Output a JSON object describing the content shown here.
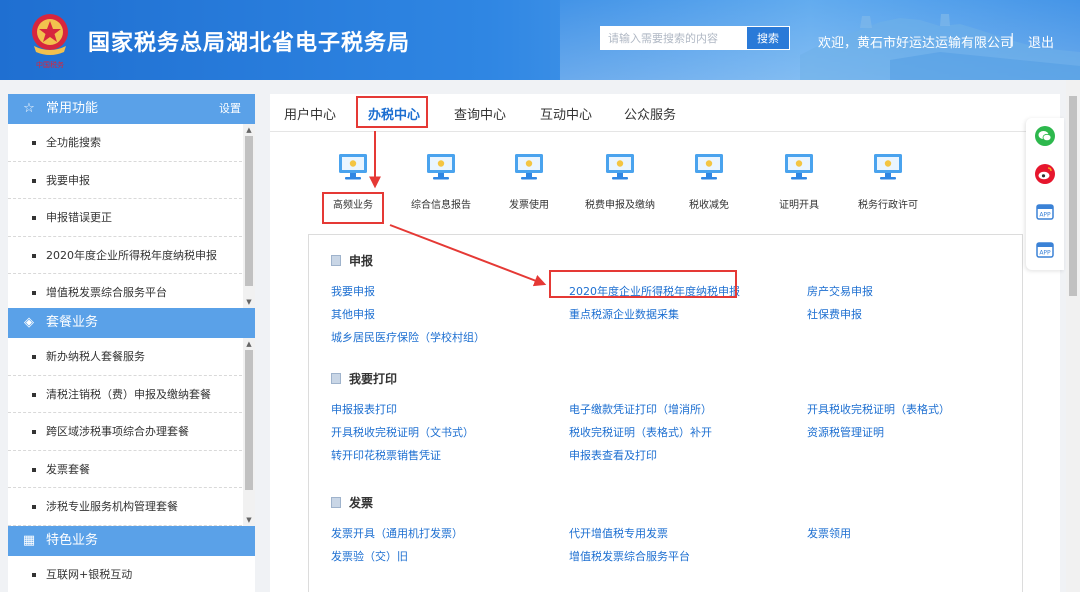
{
  "header": {
    "title": "国家税务总局湖北省电子税务局",
    "emblem_caption": "中国税务",
    "search_placeholder": "请输入需要搜索的内容",
    "search_button": "搜索",
    "welcome": "欢迎，黄石市好运达运输有限公司",
    "separator": "|",
    "logout": "退出"
  },
  "sidebar": {
    "sections": [
      {
        "title": "常用功能",
        "icon": "star-icon",
        "action": "设置",
        "items": [
          "全功能搜索",
          "我要申报",
          "申报错误更正",
          "2020年度企业所得税年度纳税申报",
          "增值税发票综合服务平台"
        ]
      },
      {
        "title": "套餐业务",
        "icon": "layers-icon",
        "items": [
          "新办纳税人套餐服务",
          "清税注销税（费）申报及缴纳套餐",
          "跨区域涉税事项综合办理套餐",
          "发票套餐",
          "涉税专业服务机构管理套餐"
        ]
      },
      {
        "title": "特色业务",
        "icon": "grid-icon",
        "items": [
          "互联网+银税互动"
        ]
      }
    ]
  },
  "tabs": [
    "用户中心",
    "办税中心",
    "查询中心",
    "互动中心",
    "公众服务"
  ],
  "active_tab": "办税中心",
  "services": [
    "高频业务",
    "综合信息报告",
    "发票使用",
    "税费申报及缴纳",
    "税收减免",
    "证明开具",
    "税务行政许可"
  ],
  "selected_service": "高频业务",
  "content": {
    "sections": [
      {
        "title": "申报",
        "links": [
          [
            "我要申报",
            "2020年度企业所得税年度纳税申报",
            "房产交易申报"
          ],
          [
            "其他申报",
            "重点税源企业数据采集",
            "社保费申报"
          ],
          [
            "城乡居民医疗保险（学校村组）"
          ]
        ]
      },
      {
        "title": "我要打印",
        "links": [
          [
            "申报报表打印",
            "电子缴款凭证打印（增消所）",
            "开具税收完税证明（表格式）"
          ],
          [
            "开具税收完税证明（文书式）",
            "税收完税证明（表格式）补开",
            "资源税管理证明"
          ],
          [
            "转开印花税票销售凭证",
            "申报表查看及打印"
          ]
        ]
      },
      {
        "title": "发票",
        "links": [
          [
            "发票开具（通用机打发票）",
            "代开增值税专用发票",
            "发票领用"
          ],
          [
            "发票验（交）旧",
            "增值税发票综合服务平台"
          ]
        ]
      }
    ]
  },
  "float_icons": [
    "wechat-icon",
    "weibo-icon",
    "app-icon",
    "app-icon"
  ],
  "colors": {
    "header_blue": "#2f86e3",
    "sidebar_head": "#5aa1e8",
    "link_blue": "#1d6fd1",
    "highlight_red": "#e53935"
  }
}
